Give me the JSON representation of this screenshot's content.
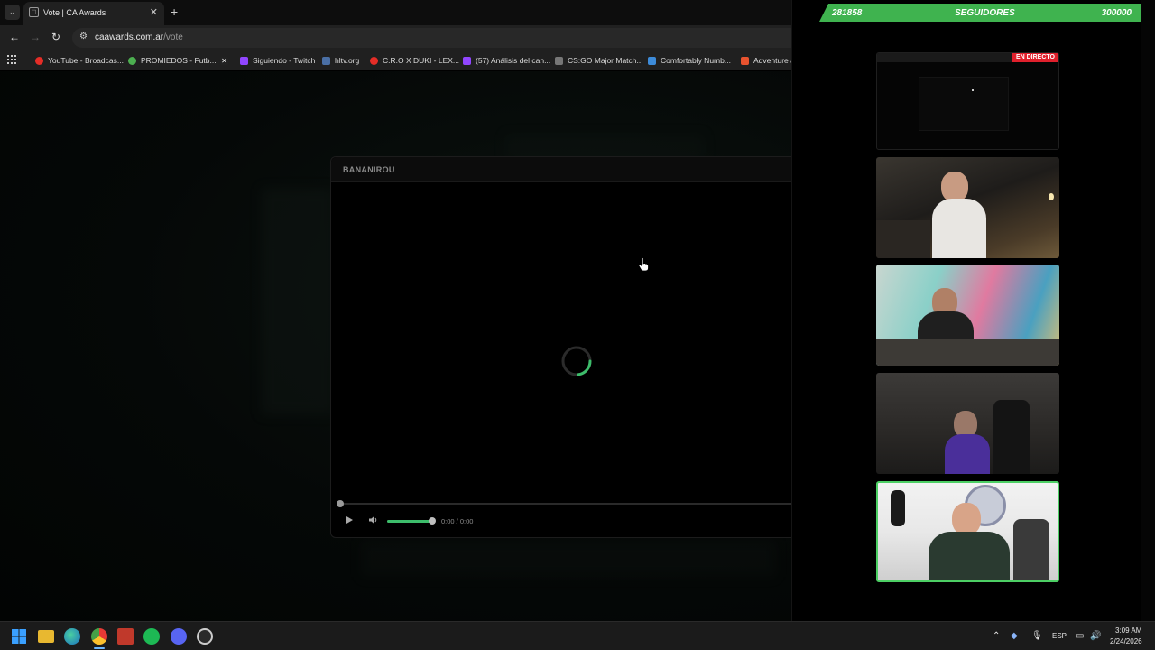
{
  "browser": {
    "tab": {
      "title": "Vote | CA Awards",
      "close": "✕"
    },
    "new_tab": "+",
    "url_host": "caawards.com.ar",
    "url_path": "/vote",
    "bookmarks": [
      {
        "label": "YouTube - Broadcas...",
        "color": "#e52d27"
      },
      {
        "label": "PROMIEDOS - Futb...",
        "color": "#4caf50"
      },
      {
        "label": "",
        "color": "#222222"
      },
      {
        "label": "Siguiendo - Twitch",
        "color": "#9146ff"
      },
      {
        "label": "hltv.org",
        "color": "#4a6fa5"
      },
      {
        "label": "C.R.O X DUKI - LEX...",
        "color": "#e52d27"
      },
      {
        "label": "(57) Análisis del can...",
        "color": "#9146ff"
      },
      {
        "label": "CS:GO Major Match...",
        "color": "#777777"
      },
      {
        "label": "Comfortably Numb...",
        "color": "#3d8bd9"
      },
      {
        "label": "Adventure a",
        "color": "#e8532f"
      }
    ]
  },
  "modal": {
    "title": "BANANIROU",
    "time": "0:00 / 0:00",
    "volume_fraction": 1.0,
    "accent": "#3dbd6b"
  },
  "overlay": {
    "followers_current": "281858",
    "followers_label": "SEGUIDORES",
    "followers_goal": "300000",
    "live_badge": "EN DIRECTO",
    "bar_color": "#3fb34f"
  },
  "taskbar": {
    "language": "ESP",
    "time": "3:09 AM",
    "date": "2/24/2026"
  }
}
